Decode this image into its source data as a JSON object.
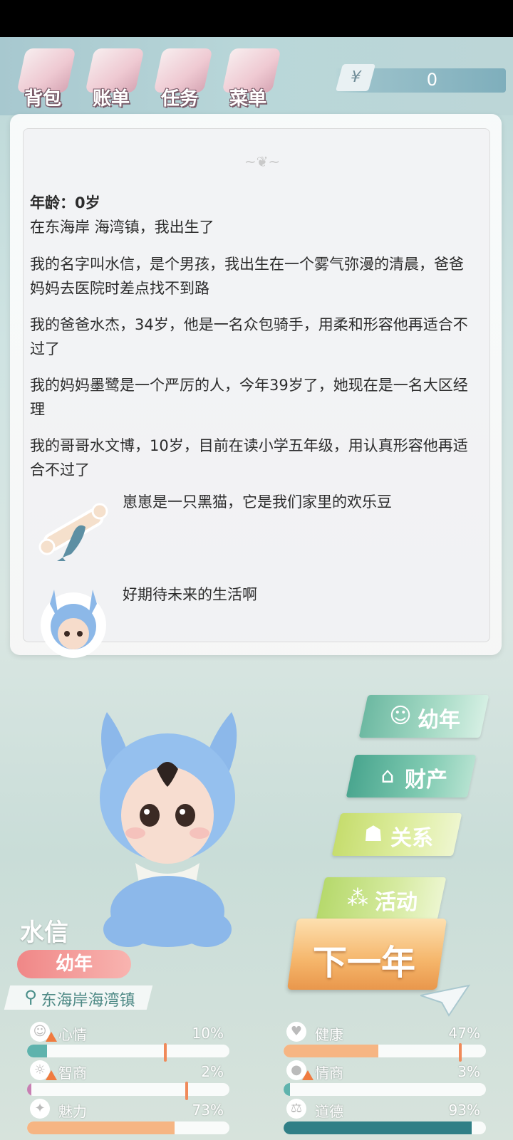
{
  "nav": {
    "items": [
      {
        "label": "背包",
        "icon": "backpack-icon"
      },
      {
        "label": "账单",
        "icon": "bill-icon"
      },
      {
        "label": "任务",
        "icon": "task-icon"
      },
      {
        "label": "菜单",
        "icon": "menu-icon"
      }
    ],
    "currency_symbol": "¥",
    "money": "0"
  },
  "story": {
    "age": "年龄：0岁",
    "lines": [
      "在东海岸 海湾镇，我出生了",
      "我的名字叫水信，是个男孩，我出生在一个雾气弥漫的清晨，爸爸妈妈去医院时差点找不到路",
      "我的爸爸水杰，34岁，他是一名众包骑手，用柔和形容他再适合不过了",
      "我的妈妈墨鹭是一个严厉的人，今年39岁了，她现在是一名大区经理",
      "我的哥哥水文博，10岁，目前在读小学五年级，用认真形容他再适合不过了"
    ],
    "events": [
      {
        "text": "崽崽是一只黑猫，它是我们家里的欢乐豆",
        "icon": "fish-bone-icon"
      },
      {
        "text": "好期待未来的生活啊",
        "icon": "baby-avatar-icon"
      }
    ]
  },
  "menu": {
    "childhood": "幼年",
    "property": "财产",
    "relations": "关系",
    "activity": "活动",
    "next_year": "下一年"
  },
  "character": {
    "name": "水信",
    "stage": "幼年",
    "location": "东海岸海湾镇"
  },
  "stats": [
    {
      "name": "心情",
      "value": "10%",
      "level": 0.1,
      "color": "#5fb3ad",
      "icon": "smile-icon",
      "warning": true
    },
    {
      "name": "健康",
      "value": "47%",
      "level": 0.47,
      "color": "#f6b583",
      "icon": "heart-icon",
      "warning": false
    },
    {
      "name": "智商",
      "value": "2%",
      "level": 0.02,
      "color": "#c77fb3",
      "icon": "brain-icon",
      "warning": true
    },
    {
      "name": "情商",
      "value": "3%",
      "level": 0.03,
      "color": "#5fb3ad",
      "icon": "apple-icon",
      "warning": true
    },
    {
      "name": "魅力",
      "value": "73%",
      "level": 0.73,
      "color": "#f6b583",
      "icon": "sparkle-icon",
      "warning": false
    },
    {
      "name": "道德",
      "value": "93%",
      "level": 0.93,
      "color": "#2f7f86",
      "icon": "scale-icon",
      "warning": false
    }
  ]
}
